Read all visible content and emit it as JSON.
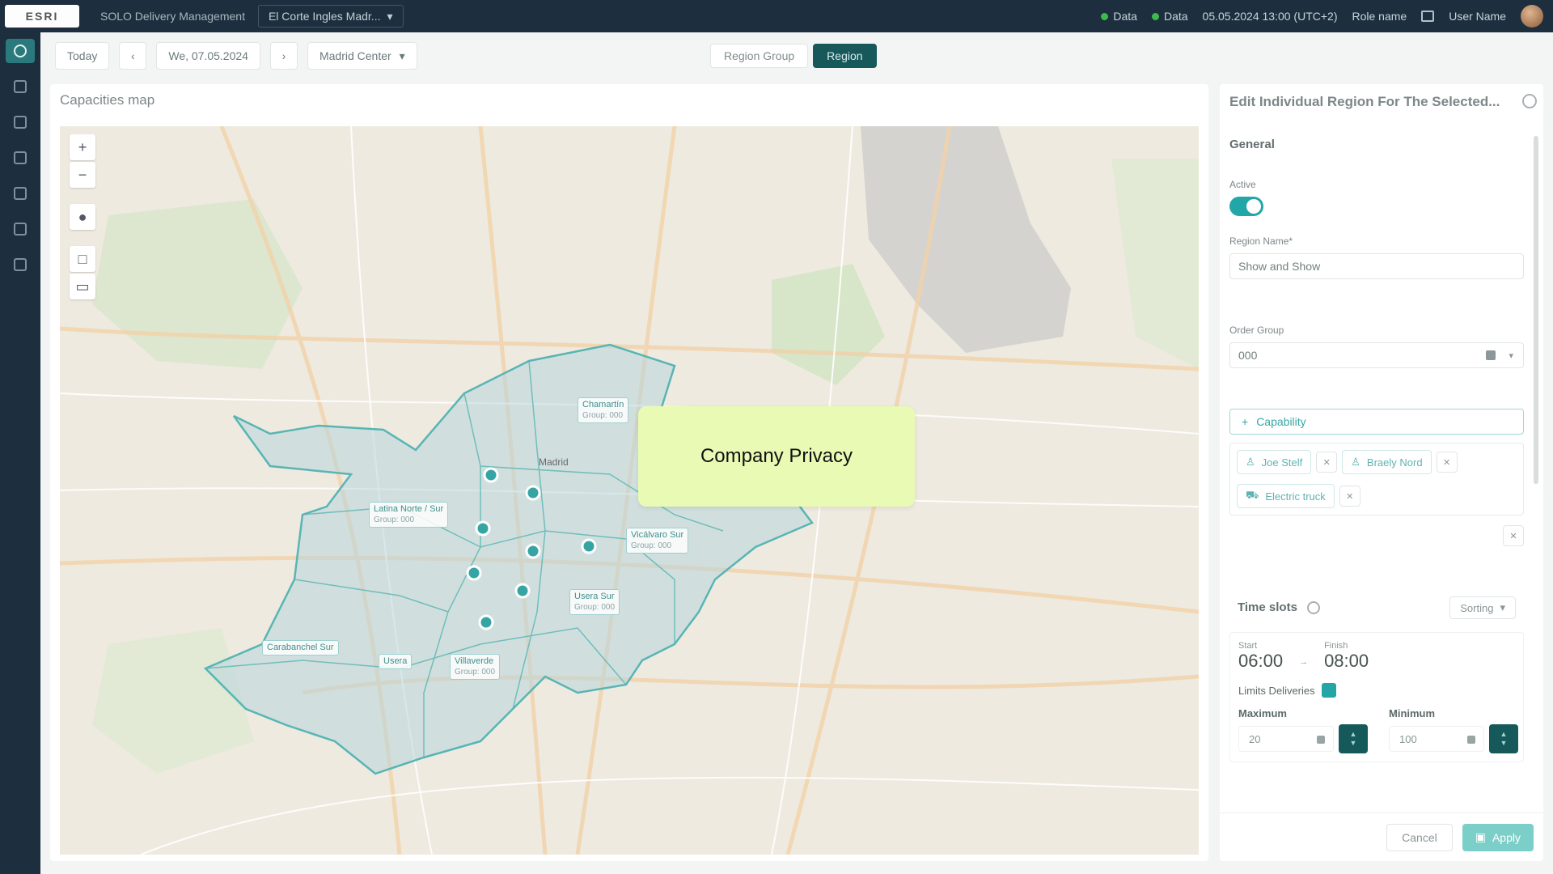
{
  "topbar": {
    "logo_text": "ESRI",
    "app_title": "SOLO Delivery Management",
    "tenant": "El Corte Ingles Madr...",
    "status_1": "Data",
    "status_2": "Data",
    "datetime": "05.05.2024 13:00 (UTC+2)",
    "role": "Role name",
    "user_name": "User Name"
  },
  "sidebar": {
    "items": [
      "home-icon",
      "truck-icon",
      "document-icon",
      "chat-icon",
      "clock-icon",
      "settings-icon",
      "megaphone-icon"
    ]
  },
  "toolbar": {
    "today_label": "Today",
    "prev_label": "‹",
    "date_label": "We, 07.05.2024",
    "next_label": "›",
    "center_label": "Madrid Center"
  },
  "view_toggle": {
    "region_group_label": "Region Group",
    "region_label": "Region"
  },
  "map_panel": {
    "title": "Capacities map",
    "zoom_in": "+",
    "zoom_out": "−",
    "region_labels": [
      {
        "name": "Chamartín",
        "sub": "Group: 000"
      },
      {
        "name": "Latina Norte / Sur",
        "sub": "Group: 000"
      },
      {
        "name": "Vicálvaro Sur",
        "sub": "Group: 000"
      },
      {
        "name": "Usera Sur",
        "sub": "Group: 000"
      },
      {
        "name": "Carabanchel Sur",
        "sub": ""
      },
      {
        "name": "Usera",
        "sub": ""
      },
      {
        "name": "Villaverde",
        "sub": "Group: 000"
      }
    ],
    "city_label": "Madrid",
    "privacy_text": "Company Privacy"
  },
  "edit_panel": {
    "title": "Edit Individual Region For The Selected...",
    "general_label": "General",
    "active_label": "Active",
    "active_value": true,
    "region_name_label": "Region Name*",
    "region_name_value": "Show and Show",
    "order_group_label": "Order Group",
    "order_group_value": "000",
    "capability_button": "Capability",
    "chips": [
      {
        "icon": "person-icon",
        "label": "Joe Stelf"
      },
      {
        "icon": "person-icon",
        "label": "Braely Nord"
      },
      {
        "icon": "van-icon",
        "label": "Electric truck"
      }
    ],
    "time_slots_label": "Time slots",
    "sorting_label": "Sorting",
    "start_label": "Start",
    "start_value": "06:00",
    "finish_label": "Finish",
    "finish_value": "08:00",
    "arrow": "→",
    "limits_label": "Limits Deliveries",
    "maximum_label": "Maximum",
    "maximum_value": "20",
    "minimum_label": "Minimum",
    "minimum_value": "100",
    "cancel_label": "Cancel",
    "apply_label": "Apply"
  }
}
